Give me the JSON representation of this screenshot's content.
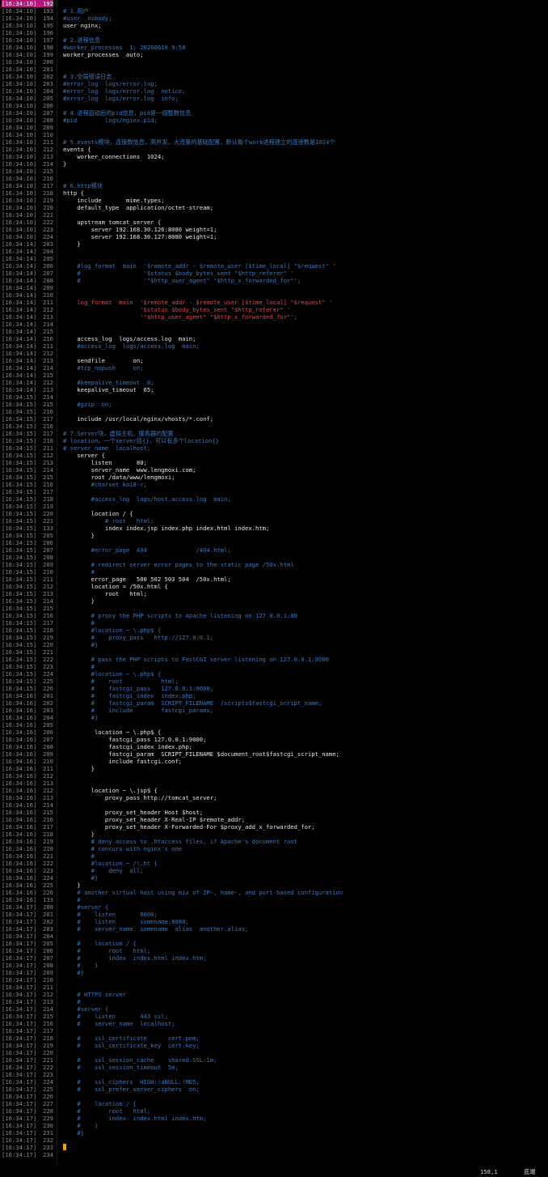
{
  "lines": [
    {
      "ts": "[16:34:10]",
      "ln": "192",
      "code": "",
      "kind": "cur"
    },
    {
      "ts": "[16:34:10]",
      "ln": "193",
      "code": "# 1.用户",
      "kind": "comment"
    },
    {
      "ts": "[16:34:10]",
      "ln": "194",
      "code": "#user  nobody;",
      "kind": "comment"
    },
    {
      "ts": "[16:34:10]",
      "ln": "195",
      "code": "user nginx;",
      "kind": "code"
    },
    {
      "ts": "[16:34:10]",
      "ln": "196",
      "code": "",
      "kind": "code"
    },
    {
      "ts": "[16:34:10]",
      "ln": "197",
      "code": "# 2.进程信息",
      "kind": "comment"
    },
    {
      "ts": "[16:34:10]",
      "ln": "198",
      "code": "#worker_processes  1; 20260610 9:58",
      "kind": "comment"
    },
    {
      "ts": "[16:34:10]",
      "ln": "199",
      "code": "worker_processes  auto;",
      "kind": "code"
    },
    {
      "ts": "[16:34:10]",
      "ln": "200",
      "code": "",
      "kind": "code"
    },
    {
      "ts": "[16:34:10]",
      "ln": "201",
      "code": "",
      "kind": "code"
    },
    {
      "ts": "[16:34:10]",
      "ln": "202",
      "code": "# 3.全局错误日志",
      "kind": "comment"
    },
    {
      "ts": "[16:34:10]",
      "ln": "203",
      "code": "#error_log  logs/error.log;",
      "kind": "comment"
    },
    {
      "ts": "[16:34:10]",
      "ln": "204",
      "code": "#error_log  logs/error.log  notice;",
      "kind": "comment"
    },
    {
      "ts": "[16:34:10]",
      "ln": "205",
      "code": "#error_log  logs/error.log  info;",
      "kind": "comment"
    },
    {
      "ts": "[16:34:10]",
      "ln": "206",
      "code": "",
      "kind": "code"
    },
    {
      "ts": "[16:34:10]",
      "ln": "207",
      "code": "# 4.进程启动后的pid信息，pid是一组整数信息",
      "kind": "comment"
    },
    {
      "ts": "[16:34:10]",
      "ln": "208",
      "code": "#pid        logs/nginx.pid;",
      "kind": "comment"
    },
    {
      "ts": "[16:34:10]",
      "ln": "209",
      "code": "",
      "kind": "code"
    },
    {
      "ts": "[16:34:10]",
      "ln": "210",
      "code": "",
      "kind": "code"
    },
    {
      "ts": "[16:34:10]",
      "ln": "211",
      "code": "# 5.events模块，连接数信息，高并发，大流量的基础配置，默认每个work进程建立的连接数是1024个",
      "kind": "comment"
    },
    {
      "ts": "[16:34:10]",
      "ln": "212",
      "code": "events {",
      "kind": "code"
    },
    {
      "ts": "[16:34:10]",
      "ln": "213",
      "code": "    worker_connections  1024;",
      "kind": "code"
    },
    {
      "ts": "[16:34:10]",
      "ln": "214",
      "code": "}",
      "kind": "code"
    },
    {
      "ts": "[16:34:10]",
      "ln": "215",
      "code": "",
      "kind": "code"
    },
    {
      "ts": "[16:34:10]",
      "ln": "216",
      "code": "",
      "kind": "code"
    },
    {
      "ts": "[16:34:10]",
      "ln": "217",
      "code": "# 6.http模块",
      "kind": "comment"
    },
    {
      "ts": "[16:34:10]",
      "ln": "218",
      "code": "http {",
      "kind": "code"
    },
    {
      "ts": "[16:34:10]",
      "ln": "219",
      "code": "    include       mime.types;",
      "kind": "code"
    },
    {
      "ts": "[16:34:10]",
      "ln": "220",
      "code": "    default_type  application/octet-stream;",
      "kind": "code"
    },
    {
      "ts": "[16:34:10]",
      "ln": "221",
      "code": "",
      "kind": "code"
    },
    {
      "ts": "[16:34:10]",
      "ln": "222",
      "code": "    upstream tomcat_server {",
      "kind": "code"
    },
    {
      "ts": "[16:34:10]",
      "ln": "223",
      "code": "        server 192.168.30.126:8080 weight=1;",
      "kind": "code"
    },
    {
      "ts": "[16:34:10]",
      "ln": "224",
      "code": "        server 192.168.30.127:8080 weight=1;",
      "kind": "code"
    },
    {
      "ts": "[16:34:14]",
      "ln": "203",
      "code": "    }",
      "kind": "code"
    },
    {
      "ts": "[16:34:14]",
      "ln": "204",
      "code": "",
      "kind": "code"
    },
    {
      "ts": "[16:34:14]",
      "ln": "205",
      "code": "",
      "kind": "code"
    },
    {
      "ts": "[16:34:14]",
      "ln": "206",
      "code": "    #log_format  main  '$remote_addr - $remote_user [$time_local] \"$request\" '",
      "kind": "comment"
    },
    {
      "ts": "[16:34:14]",
      "ln": "207",
      "code": "    #                  '$status $body_bytes_sent \"$http_referer\" '",
      "kind": "comment"
    },
    {
      "ts": "[16:34:14]",
      "ln": "208",
      "code": "    #                  '\"$http_user_agent\" \"$http_x_forwarded_for\"';",
      "kind": "comment"
    },
    {
      "ts": "[16:34:14]",
      "ln": "209",
      "code": "",
      "kind": "code"
    },
    {
      "ts": "[16:34:14]",
      "ln": "210",
      "code": "",
      "kind": "code"
    },
    {
      "ts": "[16:34:14]",
      "ln": "211",
      "code": "    log_format  main  '$remote_addr - $remote_user [$time_local] \"$request\" '",
      "kind": "str"
    },
    {
      "ts": "[16:34:14]",
      "ln": "212",
      "code": "                      '$status $body_bytes_sent \"$http_referer\" '",
      "kind": "str"
    },
    {
      "ts": "[16:34:14]",
      "ln": "213",
      "code": "                      '\"$http_user_agent\" \"$http_x_forwarded_for\"';",
      "kind": "str"
    },
    {
      "ts": "[16:34:14]",
      "ln": "214",
      "code": "",
      "kind": "code"
    },
    {
      "ts": "[16:34:14]",
      "ln": "215",
      "code": "",
      "kind": "code"
    },
    {
      "ts": "[16:34:14]",
      "ln": "216",
      "code": "    access_log  logs/access.log  main;",
      "kind": "code"
    },
    {
      "ts": "[16:34:14]",
      "ln": "211",
      "code": "    #access_log  logs/access.log  main;",
      "kind": "comment"
    },
    {
      "ts": "[16:34:14]",
      "ln": "212",
      "code": "",
      "kind": "code"
    },
    {
      "ts": "[16:34:14]",
      "ln": "213",
      "code": "    sendfile        on;",
      "kind": "code"
    },
    {
      "ts": "[16:34:14]",
      "ln": "214",
      "code": "    #tcp_nopush     on;",
      "kind": "comment"
    },
    {
      "ts": "[16:34:14]",
      "ln": "215",
      "code": "",
      "kind": "code"
    },
    {
      "ts": "[16:34:14]",
      "ln": "212",
      "code": "    #keepalive_timeout  0;",
      "kind": "comment"
    },
    {
      "ts": "[16:34:14]",
      "ln": "213",
      "code": "    keepalive_timeout  65;",
      "kind": "code"
    },
    {
      "ts": "[16:34:15]",
      "ln": "214",
      "code": "",
      "kind": "code"
    },
    {
      "ts": "[16:34:15]",
      "ln": "215",
      "code": "    #gzip  on;",
      "kind": "comment"
    },
    {
      "ts": "[16:34:15]",
      "ln": "216",
      "code": "",
      "kind": "code"
    },
    {
      "ts": "[16:34:15]",
      "ln": "217",
      "code": "    include /usr/local/nginx/vhosts/*.conf;",
      "kind": "code"
    },
    {
      "ts": "[16:34:15]",
      "ln": "216",
      "code": "",
      "kind": "code"
    },
    {
      "ts": "[16:34:15]",
      "ln": "217",
      "code": "# 7.Server块，虚拟主机，服务器的配置",
      "kind": "comment"
    },
    {
      "ts": "[16:34:15]",
      "ln": "210",
      "code": "# location，一个server括{}，可以有多个location{}",
      "kind": "comment"
    },
    {
      "ts": "[16:34:15]",
      "ln": "211",
      "code": "# server_name  localhost;",
      "kind": "comment"
    },
    {
      "ts": "[16:34:15]",
      "ln": "212",
      "code": "    server {",
      "kind": "code"
    },
    {
      "ts": "[16:34:15]",
      "ln": "213",
      "code": "        listen       80;",
      "kind": "code"
    },
    {
      "ts": "[16:34:15]",
      "ln": "214",
      "code": "        server_name  www.lengmoxi.com;",
      "kind": "code"
    },
    {
      "ts": "[16:34:15]",
      "ln": "215",
      "code": "        root /data/www/lengmoxi;",
      "kind": "code"
    },
    {
      "ts": "[16:34:15]",
      "ln": "216",
      "code": "        #charset koi8-r;",
      "kind": "comment"
    },
    {
      "ts": "[16:34:15]",
      "ln": "217",
      "code": "",
      "kind": "code"
    },
    {
      "ts": "[16:34:15]",
      "ln": "218",
      "code": "        #access_log  logs/host.access.log  main;",
      "kind": "comment"
    },
    {
      "ts": "[16:34:15]",
      "ln": "219",
      "code": "",
      "kind": "code"
    },
    {
      "ts": "[16:34:15]",
      "ln": "220",
      "code": "        location / {",
      "kind": "code"
    },
    {
      "ts": "[16:34:15]",
      "ln": "221",
      "code": "            # root   html;",
      "kind": "comment"
    },
    {
      "ts": "[16:34:15]",
      "ln": "133",
      "code": "            index index.jsp index.php index.html index.htm;",
      "kind": "code"
    },
    {
      "ts": "[16:34:15]",
      "ln": "205",
      "code": "        }",
      "kind": "code"
    },
    {
      "ts": "[16:34:15]",
      "ln": "206",
      "code": "",
      "kind": "code"
    },
    {
      "ts": "[16:34:15]",
      "ln": "207",
      "code": "        #error_page  404              /404.html;",
      "kind": "comment"
    },
    {
      "ts": "[16:34:15]",
      "ln": "208",
      "code": "",
      "kind": "code"
    },
    {
      "ts": "[16:34:15]",
      "ln": "209",
      "code": "        # redirect server error pages to the static page /50x.html",
      "kind": "comment"
    },
    {
      "ts": "[16:34:15]",
      "ln": "210",
      "code": "        #",
      "kind": "comment"
    },
    {
      "ts": "[16:34:15]",
      "ln": "211",
      "code": "        error_page   500 502 503 504  /50x.html;",
      "kind": "code"
    },
    {
      "ts": "[16:34:15]",
      "ln": "212",
      "code": "        location = /50x.html {",
      "kind": "code"
    },
    {
      "ts": "[16:34:15]",
      "ln": "213",
      "code": "            root   html;",
      "kind": "code"
    },
    {
      "ts": "[16:34:15]",
      "ln": "214",
      "code": "        }",
      "kind": "code"
    },
    {
      "ts": "[16:34:15]",
      "ln": "215",
      "code": "",
      "kind": "code"
    },
    {
      "ts": "[16:34:15]",
      "ln": "216",
      "code": "        # proxy the PHP scripts to Apache listening on 127.0.0.1:80",
      "kind": "comment"
    },
    {
      "ts": "[16:34:15]",
      "ln": "217",
      "code": "        #",
      "kind": "comment"
    },
    {
      "ts": "[16:34:15]",
      "ln": "218",
      "code": "        #location ~ \\.php$ {",
      "kind": "comment"
    },
    {
      "ts": "[16:34:15]",
      "ln": "219",
      "code": "        #    proxy_pass   http://127.0.0.1;",
      "kind": "comment"
    },
    {
      "ts": "[16:34:15]",
      "ln": "220",
      "code": "        #}",
      "kind": "comment"
    },
    {
      "ts": "[16:34:15]",
      "ln": "221",
      "code": "",
      "kind": "code"
    },
    {
      "ts": "[16:34:15]",
      "ln": "222",
      "code": "        # pass the PHP scripts to FastCGI server listening on 127.0.0.1:9000",
      "kind": "comment"
    },
    {
      "ts": "[16:34:15]",
      "ln": "223",
      "code": "        #",
      "kind": "comment"
    },
    {
      "ts": "[16:34:15]",
      "ln": "224",
      "code": "        #location ~ \\.php$ {",
      "kind": "comment"
    },
    {
      "ts": "[16:34:15]",
      "ln": "225",
      "code": "        #    root           html;",
      "kind": "comment"
    },
    {
      "ts": "[16:34:15]",
      "ln": "226",
      "code": "        #    fastcgi_pass   127.0.0.1:9000;",
      "kind": "comment"
    },
    {
      "ts": "[16:34:16]",
      "ln": "201",
      "code": "        #    fastcgi_index  index.php;",
      "kind": "comment"
    },
    {
      "ts": "[16:34:16]",
      "ln": "202",
      "code": "        #    fastcgi_param  SCRIPT_FILENAME  /scripts$fastcgi_script_name;",
      "kind": "comment"
    },
    {
      "ts": "[16:34:16]",
      "ln": "203",
      "code": "        #    include        fastcgi_params;",
      "kind": "comment"
    },
    {
      "ts": "[16:34:16]",
      "ln": "204",
      "code": "        #}",
      "kind": "comment"
    },
    {
      "ts": "[16:34:16]",
      "ln": "205",
      "code": "",
      "kind": "code"
    },
    {
      "ts": "[16:34:16]",
      "ln": "206",
      "code": "         location ~ \\.php$ {",
      "kind": "code"
    },
    {
      "ts": "[16:34:16]",
      "ln": "207",
      "code": "             fastcgi_pass 127.0.0.1:9000;",
      "kind": "code"
    },
    {
      "ts": "[16:34:16]",
      "ln": "208",
      "code": "             fastcgi_index index.php;",
      "kind": "code"
    },
    {
      "ts": "[16:34:16]",
      "ln": "209",
      "code": "             fastcgi_param  SCRIPT_FILENAME $document_root$fastcgi_script_name;",
      "kind": "code"
    },
    {
      "ts": "[16:34:16]",
      "ln": "210",
      "code": "             include fastcgi.conf;",
      "kind": "code"
    },
    {
      "ts": "[16:34:16]",
      "ln": "211",
      "code": "        }",
      "kind": "code"
    },
    {
      "ts": "[16:34:16]",
      "ln": "212",
      "code": "",
      "kind": "code"
    },
    {
      "ts": "[16:34:16]",
      "ln": "213",
      "code": "",
      "kind": "code"
    },
    {
      "ts": "[16:34:16]",
      "ln": "212",
      "code": "        location ~ \\.jsp$ {",
      "kind": "code"
    },
    {
      "ts": "[16:34:16]",
      "ln": "213",
      "code": "            proxy_pass http://tomcat_server;",
      "kind": "code"
    },
    {
      "ts": "[16:34:16]",
      "ln": "214",
      "code": "",
      "kind": "code"
    },
    {
      "ts": "[16:34:16]",
      "ln": "215",
      "code": "            proxy_set_header Host $host;",
      "kind": "code"
    },
    {
      "ts": "[16:34:16]",
      "ln": "216",
      "code": "            proxy_set_header X-Real-IP $remote_addr;",
      "kind": "code"
    },
    {
      "ts": "[16:34:16]",
      "ln": "217",
      "code": "            proxy_set_header X-Forwarded-For $proxy_add_x_forwarded_for;",
      "kind": "code"
    },
    {
      "ts": "[16:34:16]",
      "ln": "218",
      "code": "        }",
      "kind": "code"
    },
    {
      "ts": "[16:34:16]",
      "ln": "219",
      "code": "        # deny access to .htaccess files, if Apache's document root",
      "kind": "comment"
    },
    {
      "ts": "[16:34:16]",
      "ln": "220",
      "code": "        # concurs with nginx's one",
      "kind": "comment"
    },
    {
      "ts": "[16:34:16]",
      "ln": "221",
      "code": "        #",
      "kind": "comment"
    },
    {
      "ts": "[16:34:16]",
      "ln": "222",
      "code": "        #location ~ /\\.ht {",
      "kind": "comment"
    },
    {
      "ts": "[16:34:16]",
      "ln": "223",
      "code": "        #    deny  all;",
      "kind": "comment"
    },
    {
      "ts": "[16:34:16]",
      "ln": "224",
      "code": "        #}",
      "kind": "comment"
    },
    {
      "ts": "[16:34:16]",
      "ln": "225",
      "code": "    }",
      "kind": "code"
    },
    {
      "ts": "[16:34:16]",
      "ln": "226",
      "code": "    # another virtual host using mix of IP-, name-, and port-based configuration",
      "kind": "comment"
    },
    {
      "ts": "[16:34:16]",
      "ln": "133",
      "code": "    #",
      "kind": "comment"
    },
    {
      "ts": "[16:34:17]",
      "ln": "200",
      "code": "    #server {",
      "kind": "comment"
    },
    {
      "ts": "[16:34:17]",
      "ln": "201",
      "code": "    #    listen       8000;",
      "kind": "comment"
    },
    {
      "ts": "[16:34:17]",
      "ln": "202",
      "code": "    #    listen       somename:8080;",
      "kind": "comment"
    },
    {
      "ts": "[16:34:17]",
      "ln": "203",
      "code": "    #    server_name  somename  alias  another.alias;",
      "kind": "comment"
    },
    {
      "ts": "[16:34:17]",
      "ln": "204",
      "code": "",
      "kind": "code"
    },
    {
      "ts": "[16:34:17]",
      "ln": "205",
      "code": "    #    location / {",
      "kind": "comment"
    },
    {
      "ts": "[16:34:17]",
      "ln": "206",
      "code": "    #        root   html;",
      "kind": "comment"
    },
    {
      "ts": "[16:34:17]",
      "ln": "207",
      "code": "    #        index  index.html index.htm;",
      "kind": "comment"
    },
    {
      "ts": "[16:34:17]",
      "ln": "208",
      "code": "    #    }",
      "kind": "comment"
    },
    {
      "ts": "[16:34:17]",
      "ln": "209",
      "code": "    #}",
      "kind": "comment"
    },
    {
      "ts": "[16:34:17]",
      "ln": "210",
      "code": "",
      "kind": "code"
    },
    {
      "ts": "[16:34:17]",
      "ln": "211",
      "code": "",
      "kind": "code"
    },
    {
      "ts": "[16:34:17]",
      "ln": "212",
      "code": "    # HTTPS server",
      "kind": "comment"
    },
    {
      "ts": "[16:34:17]",
      "ln": "213",
      "code": "    #",
      "kind": "comment"
    },
    {
      "ts": "[16:34:17]",
      "ln": "214",
      "code": "    #server {",
      "kind": "comment"
    },
    {
      "ts": "[16:34:17]",
      "ln": "215",
      "code": "    #    listen       443 ssl;",
      "kind": "comment"
    },
    {
      "ts": "[16:34:17]",
      "ln": "216",
      "code": "    #    server_name  localhost;",
      "kind": "comment"
    },
    {
      "ts": "[16:34:17]",
      "ln": "217",
      "code": "",
      "kind": "code"
    },
    {
      "ts": "[16:34:17]",
      "ln": "218",
      "code": "    #    ssl_certificate      cert.pem;",
      "kind": "comment"
    },
    {
      "ts": "[16:34:17]",
      "ln": "219",
      "code": "    #    ssl_certificate_key  cert.key;",
      "kind": "comment"
    },
    {
      "ts": "[16:34:17]",
      "ln": "220",
      "code": "",
      "kind": "code"
    },
    {
      "ts": "[16:34:17]",
      "ln": "221",
      "code": "    #    ssl_session_cache    shared:SSL:1m;",
      "kind": "comment"
    },
    {
      "ts": "[16:34:17]",
      "ln": "222",
      "code": "    #    ssl_session_timeout  5m;",
      "kind": "comment"
    },
    {
      "ts": "[16:34:17]",
      "ln": "223",
      "code": "",
      "kind": "code"
    },
    {
      "ts": "[16:34:17]",
      "ln": "224",
      "code": "    #    ssl_ciphers  HIGH:!aNULL:!MD5;",
      "kind": "comment"
    },
    {
      "ts": "[16:34:17]",
      "ln": "225",
      "code": "    #    ssl_prefer_server_ciphers  on;",
      "kind": "comment"
    },
    {
      "ts": "[16:34:17]",
      "ln": "226",
      "code": "",
      "kind": "code"
    },
    {
      "ts": "[16:34:17]",
      "ln": "227",
      "code": "    #    location / {",
      "kind": "comment"
    },
    {
      "ts": "[16:34:17]",
      "ln": "228",
      "code": "    #        root   html;",
      "kind": "comment"
    },
    {
      "ts": "[16:34:17]",
      "ln": "229",
      "code": "    #        index  index.html index.htm;",
      "kind": "comment"
    },
    {
      "ts": "[16:34:17]",
      "ln": "230",
      "code": "    #    }",
      "kind": "comment"
    },
    {
      "ts": "[16:34:17]",
      "ln": "231",
      "code": "    #}",
      "kind": "comment"
    },
    {
      "ts": "[16:34:17]",
      "ln": "232",
      "code": "",
      "kind": "code"
    },
    {
      "ts": "[16:34:17]",
      "ln": "233",
      "code": "",
      "kind": "cursor"
    },
    {
      "ts": "[16:34:17]",
      "ln": "234",
      "code": "",
      "kind": "code"
    }
  ],
  "status": {
    "position": "158,1",
    "scroll": "底端"
  },
  "colors": {
    "background": "#000000",
    "comment": "#3f77b8",
    "string": "#d84a4a",
    "current_line": "#b0187a",
    "cursor": "#f0a000"
  }
}
